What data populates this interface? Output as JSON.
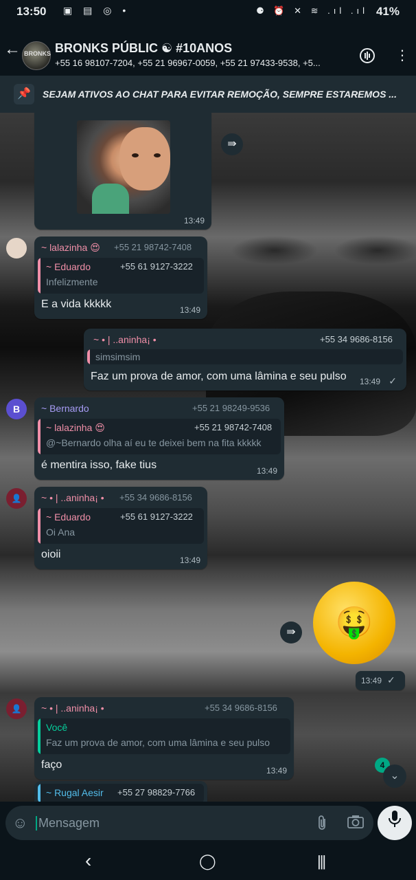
{
  "status_bar": {
    "time": "13:50",
    "left_icons": "▣ ▤ ◎ •",
    "right_icons": "⚈ ⏰ ✕ ≋ .ıl .ıl",
    "battery": "41%"
  },
  "header": {
    "back_icon": "arrow-left",
    "avatar_text": "BRONKS",
    "title": "BRONKS PÚBLIC ☯ #10ANOS",
    "subtitle": "+55 16 98107-7204, +55 21 96967-0059, +55 21 97433-9538, +5...",
    "call_icon": "voice-call-icon",
    "menu_icon": "more-vertical-icon"
  },
  "pinned": {
    "text": "SEJAM ATIVOS AO CHAT PARA EVITAR REMOÇÃO, SEMPRE ESTAREMOS ..."
  },
  "messages": [
    {
      "type": "photo",
      "time": "13:49"
    },
    {
      "sender": "~ lalazinha 😍",
      "phone": "+55 21 98742-7408",
      "quote": {
        "name": "~ Eduardo",
        "phone": "+55 61 9127-3222",
        "text": "Infelizmente"
      },
      "text": "E a vida kkkkk",
      "time": "13:49"
    },
    {
      "sender": "~ • | ..aninha¡ •",
      "phone": "+55 34 9686-8156",
      "quote": {
        "text": "simsimsim"
      },
      "text": "Faz um prova de amor, com uma lâmina e seu pulso",
      "time": "13:49",
      "tick": "✓"
    },
    {
      "avatar_letter": "B",
      "sender": "~ Bernardo",
      "phone": "+55 21 98249-9536",
      "quote": {
        "name": "~ lalazinha 😍",
        "phone": "+55 21 98742-7408",
        "text": "@~Bernardo olha aí eu te deixei bem na fita kkkkk"
      },
      "text": "é mentira isso, fake tius",
      "time": "13:49"
    },
    {
      "sender": "~ • | ..aninha¡ •",
      "phone": "+55 34 9686-8156",
      "quote": {
        "name": "~ Eduardo",
        "phone": "+55 61 9127-3222",
        "text": "Oi Ana"
      },
      "text": "oioii",
      "time": "13:49"
    },
    {
      "type": "sticker",
      "emoji": "🤑",
      "time": "13:49",
      "tick": "✓"
    },
    {
      "sender": "~ • | ..aninha¡ •",
      "phone": "+55 34 9686-8156",
      "quote": {
        "name": "Você",
        "text": "Faz um prova de amor, com uma lâmina e seu pulso"
      },
      "text": "faço",
      "time": "13:49"
    },
    {
      "sender": "~ Rugal Aesir",
      "phone": "+55 27 98829-7766"
    }
  ],
  "scroll": {
    "unread_count": "4"
  },
  "composer": {
    "placeholder": "Mensagem"
  },
  "nav": {
    "back": "‹",
    "home": "◯",
    "recents": "|||"
  },
  "colors": {
    "accent": "#00a884",
    "bubble": "#1f2c33",
    "sender_pink": "#f08fa8",
    "sender_purple": "#a79cf5",
    "quote_green": "#06cf9c",
    "quote_blue": "#53bdeb"
  }
}
